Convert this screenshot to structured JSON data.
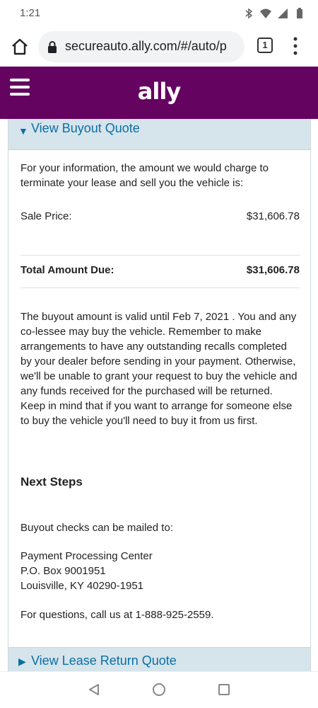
{
  "status_bar": {
    "time": "1:21"
  },
  "browser": {
    "url": "secureauto.ally.com/#/auto/p",
    "tab_count": "1"
  },
  "header": {
    "logo": "ally"
  },
  "buyout": {
    "section_title": "View Buyout Quote",
    "intro": "For your information, the amount we would charge to terminate your lease and sell you the vehicle is:",
    "sale_price_label": "Sale Price:",
    "sale_price_value": "$31,606.78",
    "total_label": "Total Amount Due:",
    "total_value": "$31,606.78",
    "validity_text": "The buyout amount is valid until Feb 7, 2021 . You and any co-lessee may buy the vehicle. Remember to make arrangements to have any outstanding recalls completed by your dealer before sending in your payment. Otherwise, we'll be unable to grant your request to buy the vehicle and any funds received for the purchased will be returned. Keep in mind that if you want to arrange for someone else to buy the vehicle you'll need to buy it from us first.",
    "next_steps_heading": "Next Steps",
    "mail_intro": "Buyout checks can be mailed to:",
    "address_line1": "Payment Processing Center",
    "address_line2": "P.O. Box 9001951",
    "address_line3": "Louisville, KY 40290-1951",
    "questions": "For questions, call us at 1-888-925-2559."
  },
  "lease_return": {
    "section_title": "View Lease Return Quote"
  },
  "colors": {
    "brand": "#650460",
    "link": "#0a6fa3",
    "accordion_bg": "#d6e4ec"
  }
}
